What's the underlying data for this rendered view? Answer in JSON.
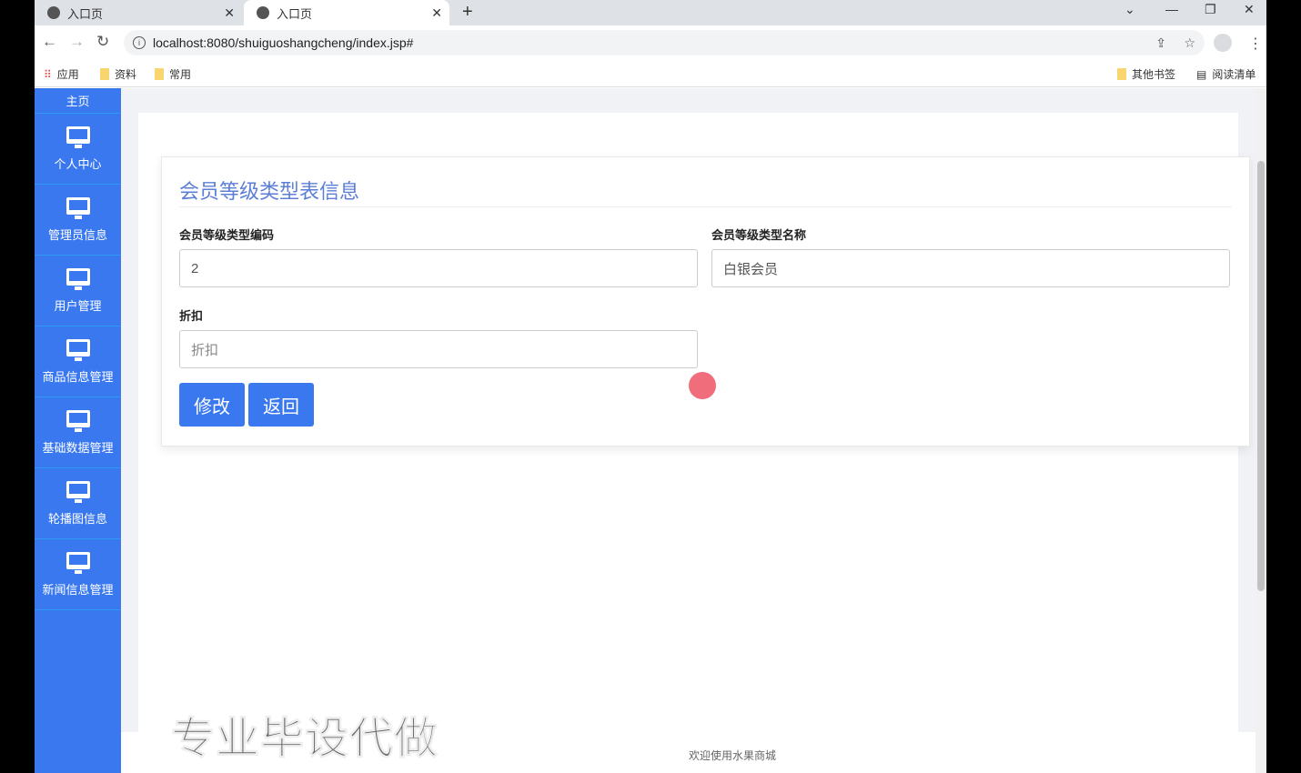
{
  "browser": {
    "tabs": [
      {
        "label": "入口页"
      },
      {
        "label": "入口页"
      }
    ],
    "url": "localhost:8080/shuiguoshangcheng/index.jsp#",
    "bookmarks": [
      "应用",
      "资料",
      "常用"
    ],
    "other_bookmarks": "其他书签",
    "reading_list": "阅读清单"
  },
  "sidebar": {
    "items": [
      {
        "label": "主页"
      },
      {
        "label": "个人中心"
      },
      {
        "label": "管理员信息"
      },
      {
        "label": "用户管理"
      },
      {
        "label": "商品信息管理"
      },
      {
        "label": "基础数据管理"
      },
      {
        "label": "轮播图信息"
      },
      {
        "label": "新闻信息管理"
      }
    ]
  },
  "form": {
    "title": "会员等级类型表信息",
    "code_label": "会员等级类型编码",
    "code_value": "2",
    "name_label": "会员等级类型名称",
    "name_value": "白银会员",
    "discount_label": "折扣",
    "discount_placeholder": "折扣",
    "submit": "修改",
    "back": "返回"
  },
  "footer": {
    "text": "欢迎使用水果商城"
  },
  "watermark": "专业毕设代做"
}
